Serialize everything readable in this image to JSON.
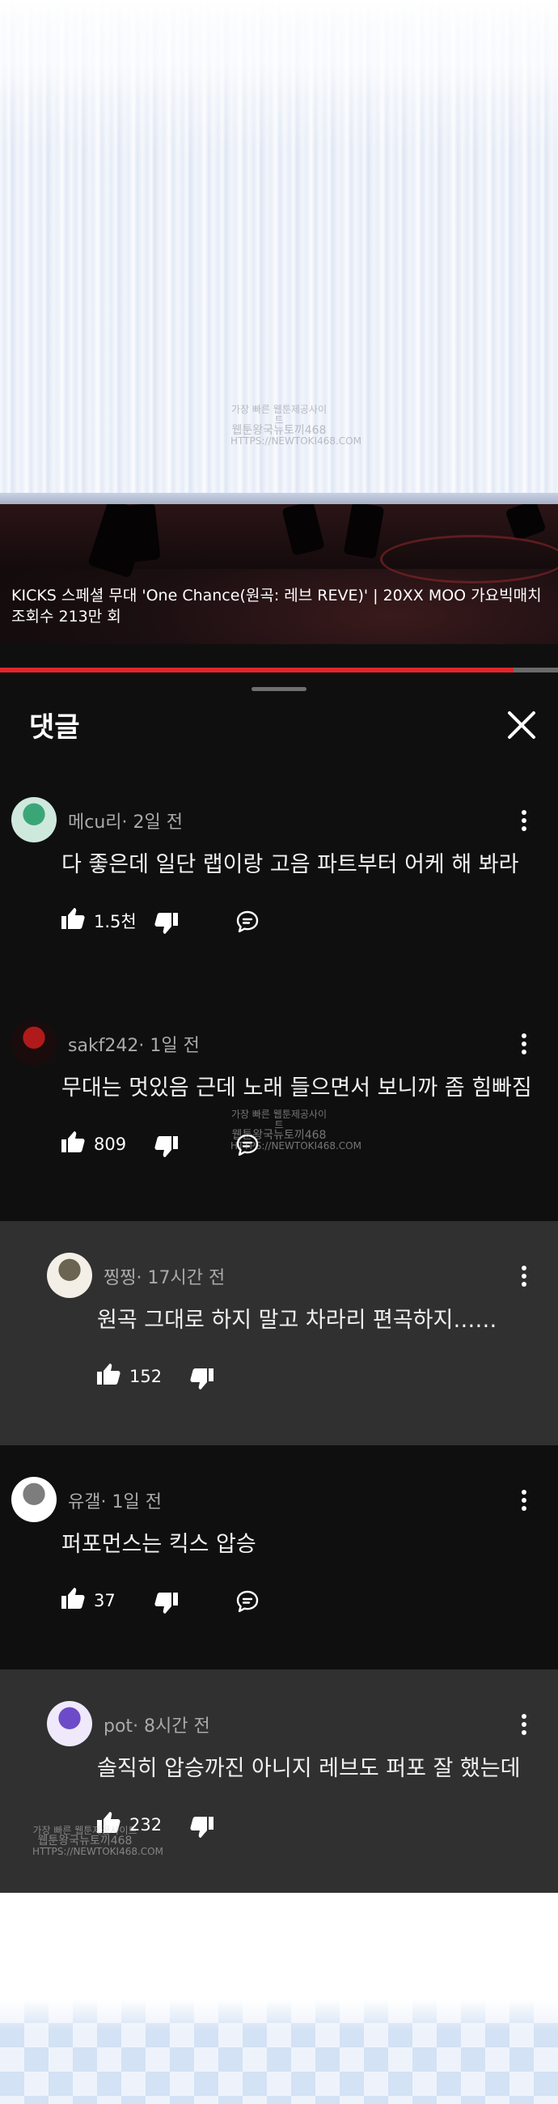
{
  "video": {
    "caption_line1": "KICKS 스페셜 무대 'One Chance(원곡: 레브 REVE)' | 20XX MOO 가요빅매치",
    "caption_line2": "조회수 213만 회",
    "progress_percent": 92
  },
  "comments_panel": {
    "title": "댓글"
  },
  "watermark": {
    "line1": "가장 빠른 웹툰제공사이트",
    "line2": "웹툰왕국뉴토끼468",
    "line3": "HTTPS://NEWTOKI468.COM"
  },
  "comments": [
    {
      "author": "메cu리",
      "time": "· 2일 전",
      "text": "다 좋은데 일단 랩이랑 고음 파트부터 어케 해 봐라",
      "likes": "1.5천",
      "is_reply": false,
      "avatar_colors": [
        "#cfe8dd",
        "#3aa678"
      ]
    },
    {
      "author": "sakf242",
      "time": "· 1일 전",
      "text": "무대는 멋있음 근데 노래 들으면서 보니까 좀 힘빠짐",
      "likes": "809",
      "is_reply": false,
      "avatar_colors": [
        "#1a0c0c",
        "#b01a1a"
      ]
    },
    {
      "author": "찡찡",
      "time": "· 17시간 전",
      "text": "원곡 그대로 하지 말고 차라리 편곡하지……",
      "likes": "152",
      "is_reply": true,
      "avatar_colors": [
        "#f3efe6",
        "#6b6450"
      ]
    },
    {
      "author": "유갤",
      "time": "· 1일 전",
      "text": "퍼포먼스는 킥스 압승",
      "likes": "37",
      "is_reply": false,
      "avatar_colors": [
        "#ffffff",
        "#7d7d7d"
      ]
    },
    {
      "author": "pot",
      "time": "· 8시간 전",
      "text": "솔직히 압승까진 아니지 레브도 퍼포 잘 했는데",
      "likes": "232",
      "is_reply": true,
      "avatar_colors": [
        "#efe9fb",
        "#6d4bc8"
      ]
    }
  ]
}
